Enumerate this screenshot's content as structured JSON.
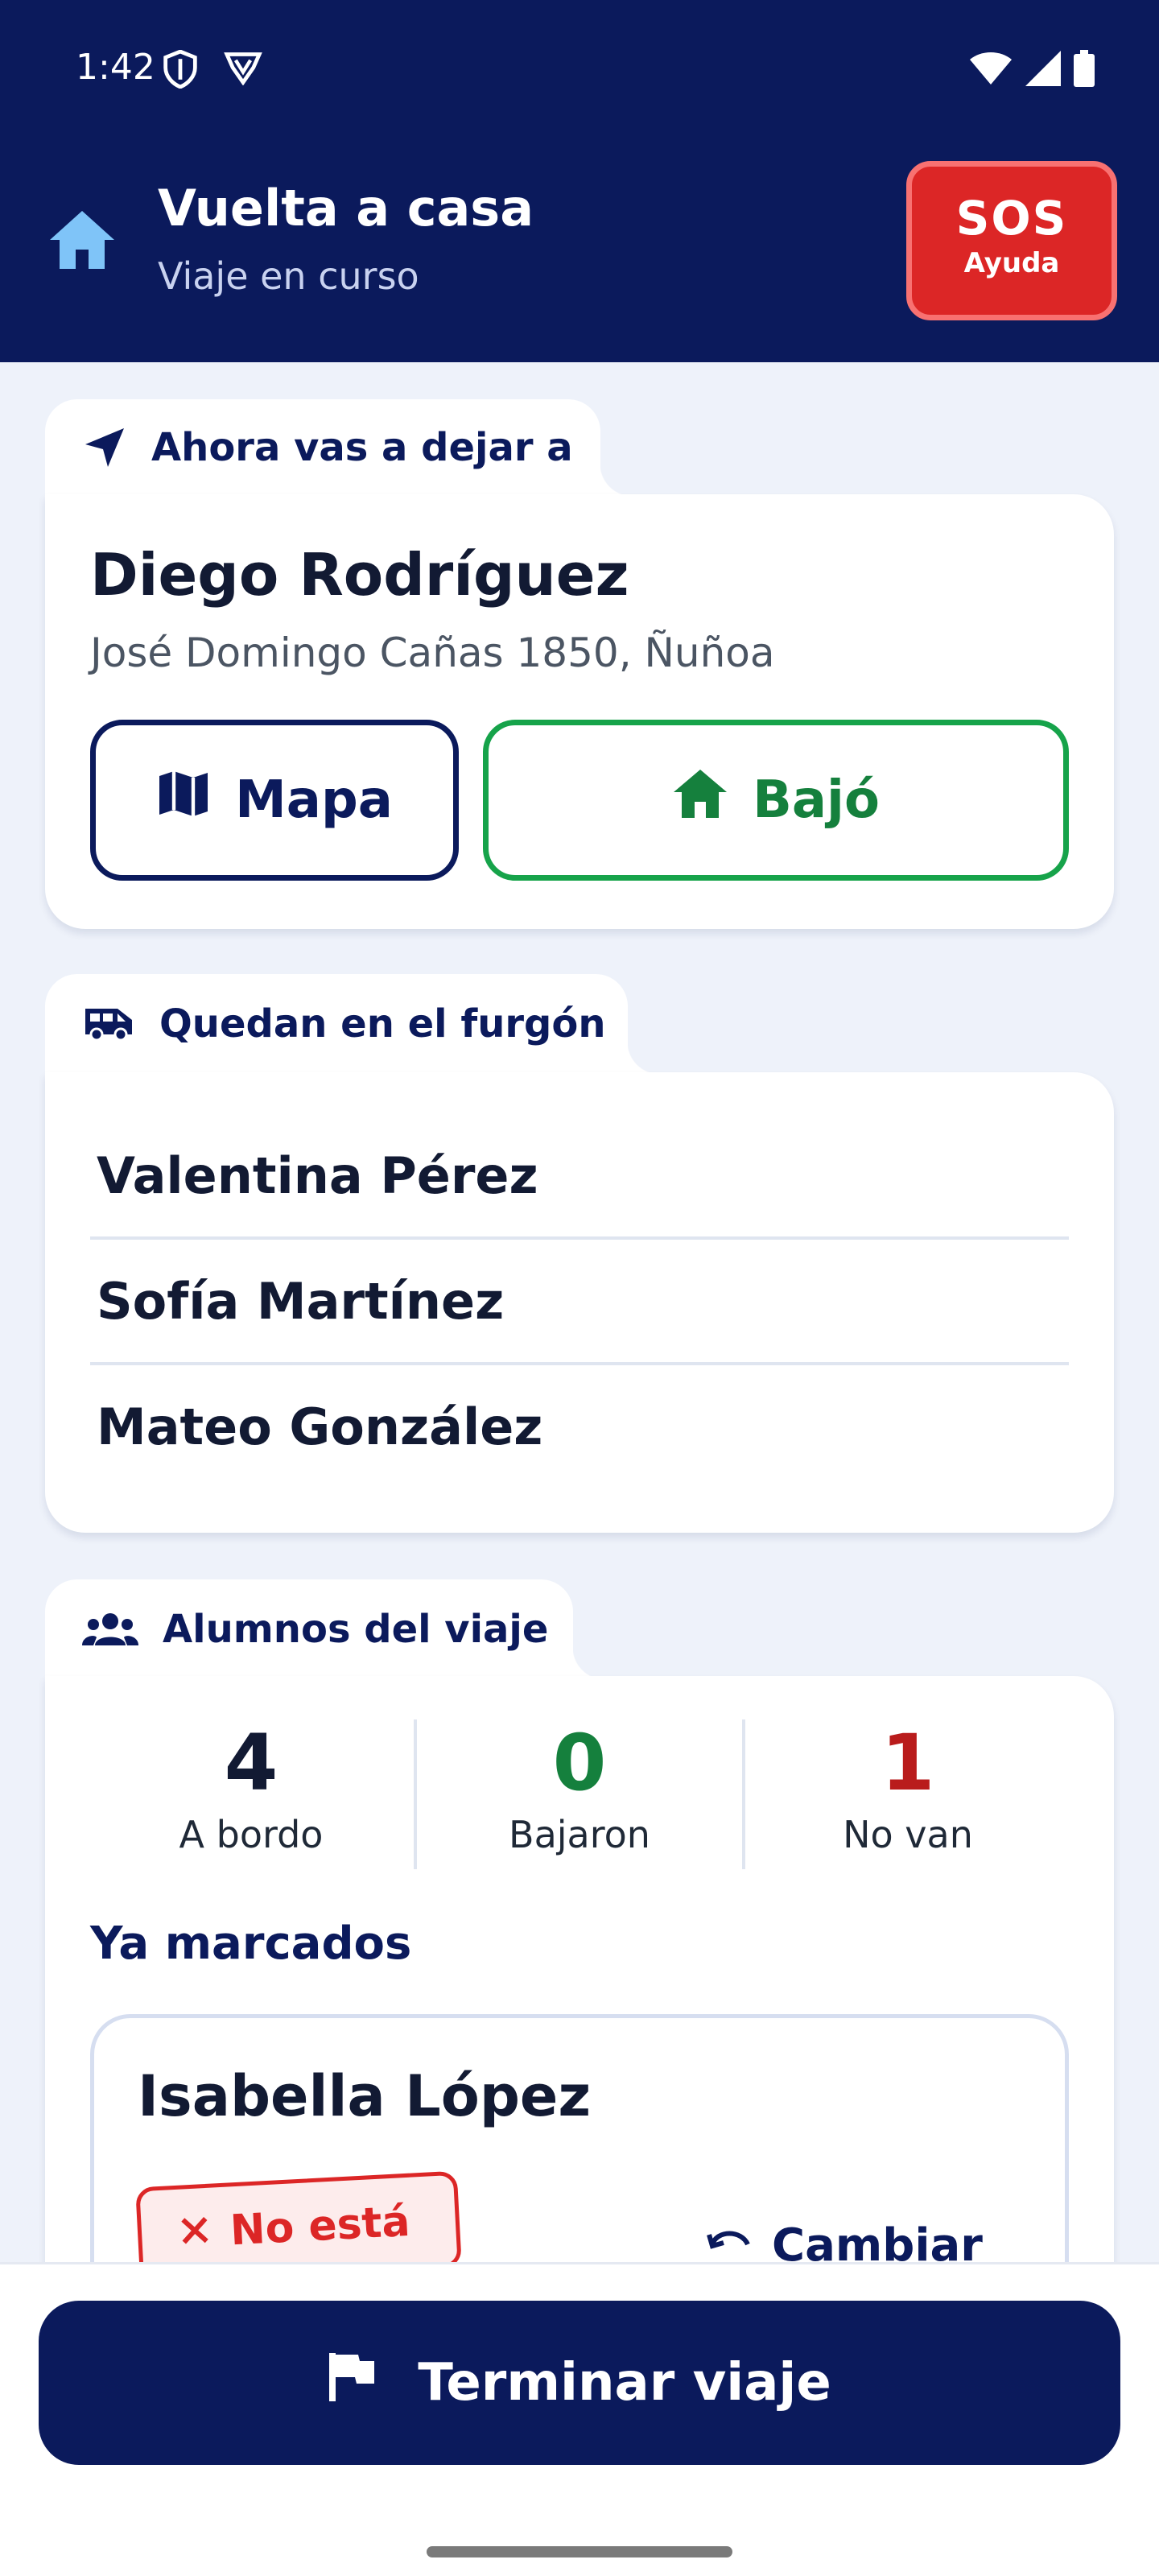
{
  "status_bar": {
    "time": "1:42",
    "icons": [
      "shield-icon",
      "vpn-shield-icon",
      "wifi-icon",
      "signal-icon",
      "battery-icon"
    ]
  },
  "header": {
    "title": "Vuelta a casa",
    "subtitle": "Viaje en curso",
    "icon": "home-icon",
    "sos": {
      "label": "SOS",
      "sublabel": "Ayuda"
    }
  },
  "current_dropoff": {
    "tab_label": "Ahora vas a dejar a",
    "tab_icon": "navigation-arrow-icon",
    "student_name": "Diego Rodríguez",
    "address": "José Domingo Cañas 1850, Ñuñoa",
    "map_button": "Mapa",
    "dropped_button": "Bajó"
  },
  "remaining": {
    "tab_label": "Quedan en el furgón",
    "tab_icon": "van-icon",
    "students": [
      "Valentina Pérez",
      "Sofía Martínez",
      "Mateo González"
    ]
  },
  "trip_students": {
    "tab_label": "Alumnos del viaje",
    "tab_icon": "group-icon",
    "stats": [
      {
        "value": "4",
        "label": "A bordo",
        "color": "#121a33"
      },
      {
        "value": "0",
        "label": "Bajaron",
        "color": "#15803d"
      },
      {
        "value": "1",
        "label": "No van",
        "color": "#b91c1c"
      }
    ],
    "marked_label": "Ya marcados",
    "marked": [
      {
        "name": "Isabella López",
        "status": "No está",
        "action": "Cambiar"
      }
    ]
  },
  "footer": {
    "finish_button": "Terminar viaje",
    "finish_icon": "flag-icon"
  },
  "colors": {
    "primary": "#0b1a5c",
    "background": "#eef2fa",
    "danger": "#dc2626",
    "success": "#16a34a"
  }
}
